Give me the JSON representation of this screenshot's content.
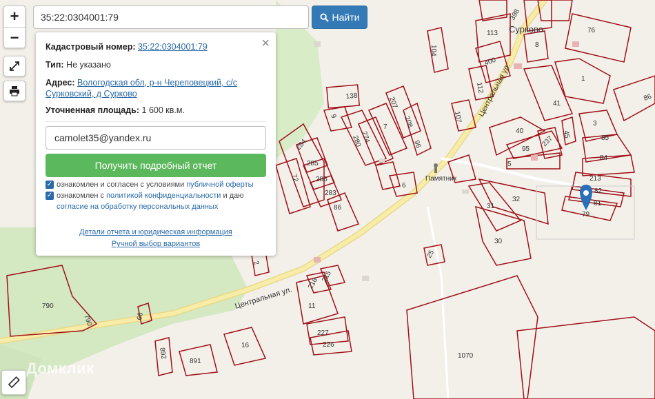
{
  "search": {
    "value": "35:22:0304001:79",
    "find_label": "Найти"
  },
  "zoom": {
    "in_label": "+",
    "out_label": "−"
  },
  "panel": {
    "cadastral_label": "Кадастровый номер:",
    "cadastral_value": "35:22:0304001:79",
    "type_label": "Тип:",
    "type_value": "Не указано",
    "address_label": "Адрес:",
    "address_line1": "Вологодская обл, р-н Череповецкий, с/с",
    "address_line2": "Сурковский, д Сурково",
    "area_label": "Уточненная площадь:",
    "area_value": "1 600 кв.м.",
    "email_value": "camolet35@yandex.ru",
    "report_button": "Получить подробный отчет",
    "agree1_text": "ознакомлен и согласен с условиями",
    "agree1_link": "публичной оферты",
    "agree2_text": "ознакомлен с",
    "agree2_link1": "политикой конфиденциальности",
    "agree2_mid": "и даю",
    "agree2_link2": "согласие на обработку персональных данных",
    "details_link": "Детали отчета и юридическая информация",
    "manual_link": "Ручной выбор вариантов"
  },
  "map_labels": {
    "village": "Сурково",
    "monument": "Памятник",
    "street1": "Центральная ул.",
    "street2": "Центральная ул.",
    "parcels": [
      "104",
      "113",
      "398",
      "76",
      "8",
      "400",
      "112",
      "1",
      "138",
      "207",
      "208",
      "9",
      "7",
      "274",
      "280",
      "96",
      "107",
      "41",
      "40",
      "95",
      "237",
      "45",
      "3",
      "85",
      "84",
      "213",
      "82",
      "81",
      "79",
      "5",
      "284",
      "285",
      "286",
      "283",
      "72",
      "86",
      "6",
      "32",
      "31",
      "30",
      "25",
      "216",
      "215",
      "11",
      "227",
      "226",
      "16",
      "891",
      "892",
      "790",
      "790",
      "66",
      "1070",
      "2",
      "86"
    ]
  },
  "logo": "Домклик",
  "colors": {
    "primary": "#337ab7",
    "success": "#5cb85c",
    "parcel": "#a01018",
    "road": "#f6e79a"
  }
}
